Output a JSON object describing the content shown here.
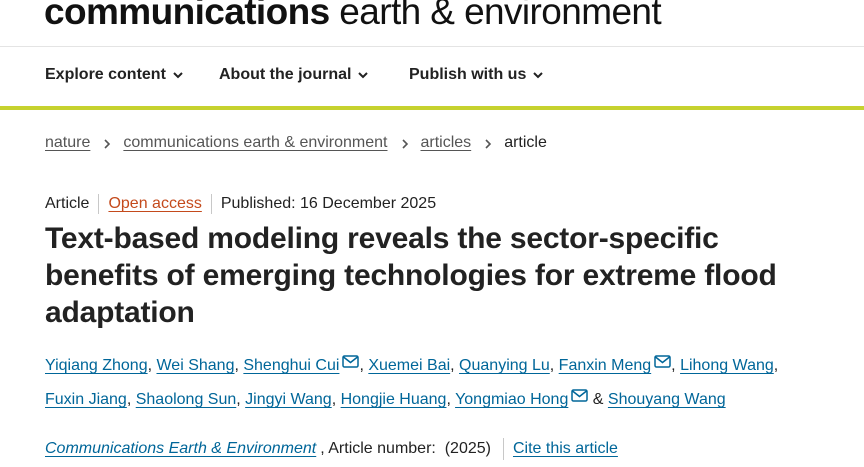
{
  "logo": {
    "bold": "communications",
    "light": "earth & environment"
  },
  "nav": {
    "items": [
      {
        "label": "Explore content"
      },
      {
        "label": "About the journal"
      },
      {
        "label": "Publish with us"
      }
    ]
  },
  "breadcrumb": {
    "items": [
      "nature",
      "communications earth & environment",
      "articles"
    ],
    "current": "article"
  },
  "meta": {
    "type": "Article",
    "access": "Open access",
    "published": "Published: 16 December 2025"
  },
  "title": {
    "lines": [
      "Text-based modeling reveals the sector-specific",
      "benefits of emerging technologies for extreme flood",
      "adaptation"
    ]
  },
  "authors": [
    "Yiqiang Zhong",
    "Wei Shang",
    "Shenghui Cui",
    "Xuemei Bai",
    "Quanying Lu",
    "Fanxin Meng",
    "Lihong Wang",
    "Fuxin Jiang",
    "Shaolong Sun",
    "Jingyi Wang",
    "Hongjie Huang",
    "Yongmiao Hong",
    "Shouyang Wang"
  ],
  "authors_connector": "&",
  "citation": {
    "journal": "Communications Earth & Environment",
    "article_number": ", Article number:  (2025)",
    "cite_label": "Cite this article"
  },
  "icons": {
    "nav_chevron": "chevron-down-icon",
    "breadcrumb_separator": "chevron-right-icon",
    "corresponding_author": "mail-icon"
  },
  "colors": {
    "accent_bar": "#c6d22e",
    "link": "#006699",
    "open_access": "#c44a1c",
    "text": "#222222"
  }
}
